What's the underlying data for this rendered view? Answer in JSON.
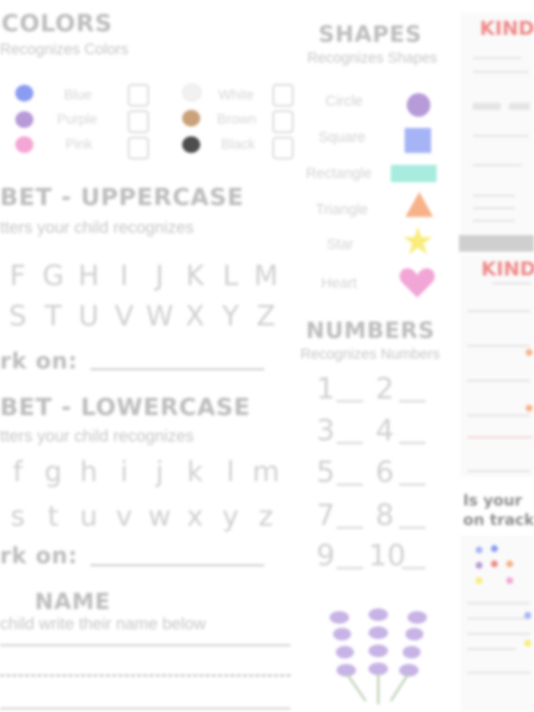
{
  "colors": {
    "title": "COLORS",
    "subtitle": "Recognizes Colors",
    "items": [
      {
        "label": "Blue",
        "color": "#8b9bf2"
      },
      {
        "label": "Purple",
        "color": "#b79ad8"
      },
      {
        "label": "Pink",
        "color": "#f4a6d4"
      },
      {
        "label": "White",
        "color": "#f1f1f1"
      },
      {
        "label": "Brown",
        "color": "#c9a27a"
      },
      {
        "label": "Black",
        "color": "#4d4d4d"
      }
    ]
  },
  "uppercase": {
    "title": "BET - UPPERCASE",
    "subtitle": "tters your child recognizes",
    "row1": [
      "F",
      "G",
      "H",
      "I",
      "J",
      "K",
      "L",
      "M"
    ],
    "row2": [
      "S",
      "T",
      "U",
      "V",
      "W",
      "X",
      "Y",
      "Z"
    ],
    "work_on": "rk on:"
  },
  "lowercase": {
    "title": "BET - LOWERCASE",
    "subtitle": "tters your child recognizes",
    "row1": [
      "f",
      "g",
      "h",
      "i",
      "j",
      "k",
      "l",
      "m"
    ],
    "row2": [
      "s",
      "t",
      "u",
      "v",
      "w",
      "x",
      "y",
      "z"
    ],
    "work_on": "rk on:"
  },
  "name": {
    "title": "NAME",
    "subtitle": "child write their name below"
  },
  "shapes": {
    "title": "SHAPES",
    "subtitle": "Recognizes Shapes",
    "items": [
      {
        "label": "Circle",
        "icon": "circle-icon",
        "color": "#b79ad8"
      },
      {
        "label": "Square",
        "icon": "square-icon",
        "color": "#a6b4f6"
      },
      {
        "label": "Rectangle",
        "icon": "rectangle-icon",
        "color": "#a7ecdf"
      },
      {
        "label": "Triangle",
        "icon": "triangle-icon",
        "color": "#f7b289"
      },
      {
        "label": "Star",
        "icon": "star-icon",
        "color": "#f9ec7a"
      },
      {
        "label": "Heart",
        "icon": "heart-icon",
        "color": "#f1a6d6"
      }
    ]
  },
  "numbers": {
    "title": "NUMBERS",
    "subtitle": "Recognizes Numbers",
    "items": [
      "1",
      "2",
      "3",
      "4",
      "5",
      "6",
      "7",
      "8",
      "9",
      "10"
    ]
  },
  "preview": {
    "top_title": "KIND",
    "mid_title": "KIND",
    "bottom_heading_1": "Is your",
    "bottom_heading_2": "on track",
    "accent": "#f08a8a"
  }
}
